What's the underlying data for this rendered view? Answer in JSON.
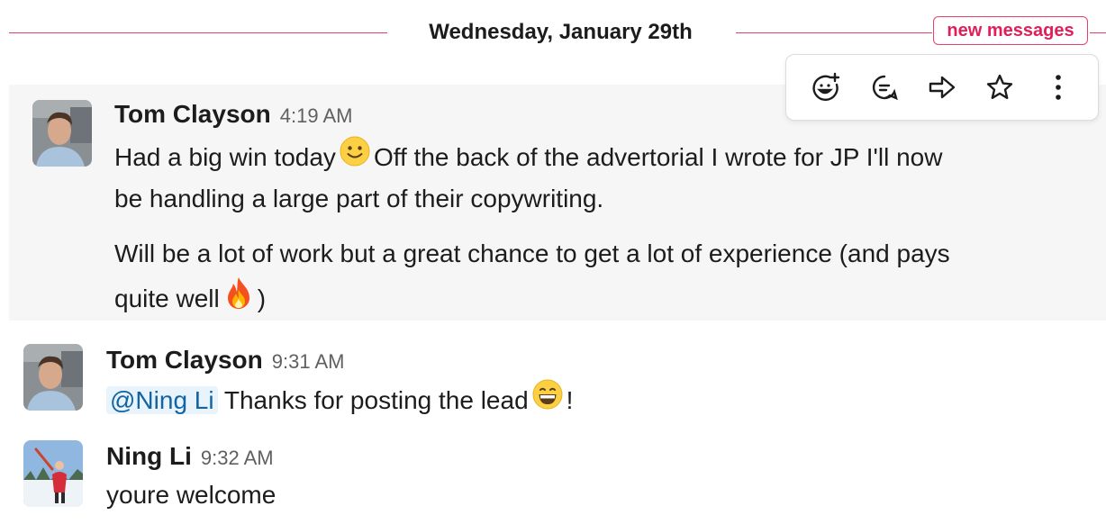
{
  "divider": {
    "date": "Wednesday, January 29th",
    "new_messages": "new messages"
  },
  "toolbar": {
    "actions": [
      {
        "name": "add-reaction-icon"
      },
      {
        "name": "reply-in-thread-icon"
      },
      {
        "name": "share-message-icon"
      },
      {
        "name": "save-star-icon"
      },
      {
        "name": "more-actions-icon"
      }
    ]
  },
  "messages": [
    {
      "sender": "Tom Clayson",
      "time": "4:19 AM",
      "lines": {
        "l1a": "Had a big win today",
        "l1b": "Off the back of the advertorial I wrote for JP I'll now",
        "l2": "be handling a large part of their copywriting.",
        "l3": "Will be a lot of work but a great chance to get a lot of experience (and pays",
        "l4a": "quite well",
        "l4b": ")"
      },
      "emojis": [
        "slightly-smiling-face",
        "fire"
      ]
    },
    {
      "sender": "Tom Clayson",
      "time": "9:31 AM",
      "mention": "@Ning Li",
      "text": "Thanks for posting the lead",
      "text_end": "!",
      "emojis": [
        "grinning-face"
      ]
    },
    {
      "sender": "Ning Li",
      "time": "9:32 AM",
      "text": "youre welcome"
    }
  ],
  "colors": {
    "accent": "#e8406d",
    "badge_text": "#e01e5a",
    "mention_bg": "#e8f3fb",
    "mention_text": "#1264a3",
    "hover_bg": "#f6f6f6"
  }
}
